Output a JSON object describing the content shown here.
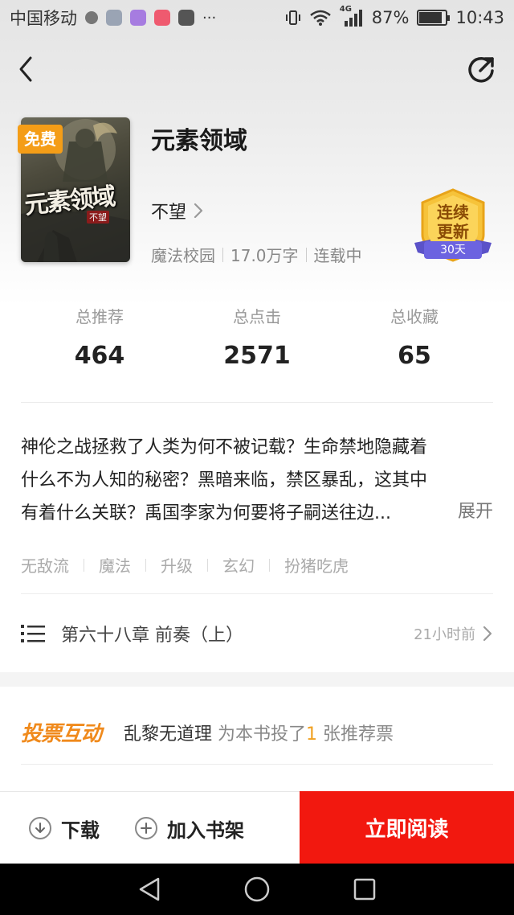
{
  "status_bar": {
    "carrier": "中国移动",
    "network": "4G",
    "battery": "87%",
    "battery_level": 0.87,
    "time": "10:43"
  },
  "book": {
    "free_badge": "免费",
    "cover_title": "元素领域",
    "cover_author": "不望",
    "title": "元素领域",
    "author": "不望",
    "category": "魔法校园",
    "word_count": "17.0万字",
    "status": "连载中",
    "update_badge": {
      "line1": "连续",
      "line2": "更新",
      "days": "30天",
      "color": "#f4b428"
    }
  },
  "stats": [
    {
      "label": "总推荐",
      "value": "464"
    },
    {
      "label": "总点击",
      "value": "2571"
    },
    {
      "label": "总收藏",
      "value": "65"
    }
  ],
  "synopsis": {
    "lines": [
      "神伦之战拯救了人类为何不被记载？生命禁地隐藏着",
      "什么不为人知的秘密？黑暗来临，禁区暴乱，这其中",
      "有着什么关联？禹国李家为何要将子嗣送往边..."
    ],
    "expand": "展开"
  },
  "tags": [
    "无敌流",
    "魔法",
    "升级",
    "玄幻",
    "扮猪吃虎"
  ],
  "latest_chapter": {
    "title": "第六十八章  前奏（上）",
    "time": "21小时前"
  },
  "vote": {
    "logo": "投票互动",
    "user": "乱黎无道理",
    "text_before": " 为本书投了",
    "count": "1",
    "text_after": " 张推荐票"
  },
  "bottom_bar": {
    "download": "下载",
    "add_shelf": "加入书架",
    "read_now": "立即阅读",
    "accent": "#f2180f"
  }
}
